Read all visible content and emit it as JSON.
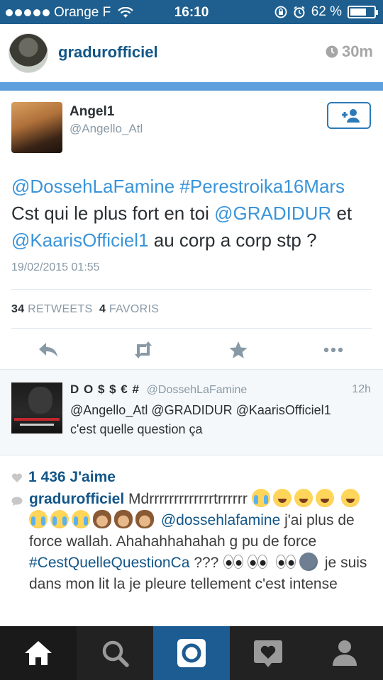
{
  "status_bar": {
    "carrier": "Orange F",
    "time": "16:10",
    "battery_percent": "62 %",
    "battery_level": 0.62,
    "icons": [
      "signal-dots",
      "wifi-icon",
      "rotation-lock-icon",
      "alarm-icon",
      "battery-icon"
    ]
  },
  "post": {
    "username": "gradurofficiel",
    "time_ago": "30m"
  },
  "tweet": {
    "name": "Angel1",
    "handle": "@Angello_Atl",
    "text_parts": {
      "mention1": "@DossehLaFamine",
      "hashtag1": "#Perestroika16Mars",
      "line2_text": "Cst qui le plus fort en toi",
      "mention2": "@GRADIDUR",
      "line2_end": "et",
      "mention3": "@KaarisOfficiel1",
      "line3_text": "au corp a corp stp ?"
    },
    "date": "19/02/2015 01:55",
    "retweets_count": "34",
    "retweets_label": "RETWEETS",
    "favorites_count": "4",
    "favorites_label": "FAVORIS",
    "actions": [
      "reply-icon",
      "retweet-icon",
      "favorite-icon",
      "more-icon"
    ]
  },
  "reply": {
    "name": "D O $ $ € #",
    "handle": "@DossehLaFamine",
    "time": "12h",
    "line1": "@Angello_Atl @GRADIDUR @KaarisOfficiel1",
    "line2": "c'est quelle question ça"
  },
  "likes": {
    "text": "1 436 J'aime"
  },
  "caption": {
    "user": "gradurofficiel",
    "text1": "Mdrrrrrrrrrrrrrtrrrrrr",
    "mention": "@dossehlafamine",
    "text2": "j'ai plus de force wallah. Ahahahhahahah g pu de force",
    "hashtag": "#CestQuelleQuestionCa",
    "text3": "???",
    "text4": "je suis dans mon lit la je pleure tellement c'est intense"
  },
  "tabbar": {
    "tabs": [
      "home-icon",
      "search-icon",
      "camera-icon",
      "activity-heart-icon",
      "profile-icon"
    ]
  },
  "colors": {
    "instagram_blue": "#125688",
    "twitter_link": "#3b94d9",
    "status_bar": "#1e5f8f",
    "divider_blue": "#5da0dd",
    "tab_bar": "#222222",
    "camera_tab": "#1d5c92"
  }
}
